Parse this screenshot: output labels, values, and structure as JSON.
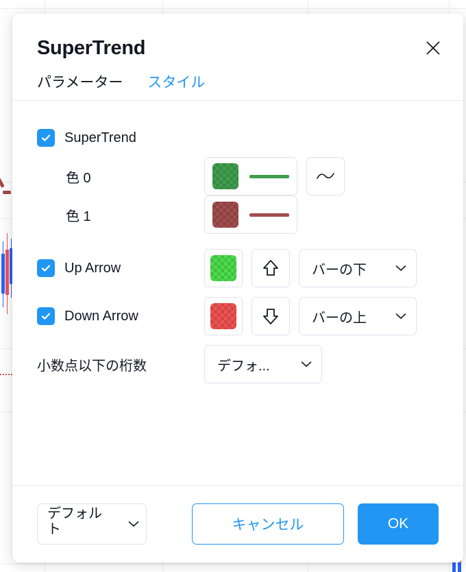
{
  "dialog": {
    "title": "SuperTrend",
    "close_icon": "close-icon",
    "tabs": [
      {
        "label": "パラメーター",
        "active": false
      },
      {
        "label": "スタイル",
        "active": true
      }
    ],
    "rows": [
      {
        "id": "supertrend",
        "label": "SuperTrend",
        "checked": true,
        "checkbox_color": "#2196f3"
      },
      {
        "id": "color-0",
        "label": "色 0",
        "swatch_color": "#3f9e4d",
        "line_color": "#3f9e4d",
        "line_style_icon": "wave-line-icon"
      },
      {
        "id": "color-1",
        "label": "色 1",
        "swatch_color": "#a34d4d",
        "line_color": "#a34d4d"
      },
      {
        "id": "up-arrow",
        "label": "Up Arrow",
        "checked": true,
        "swatch_color": "#4cdc4c",
        "arrow_icon": "arrow-up-icon",
        "position": "バーの下"
      },
      {
        "id": "down-arrow",
        "label": "Down Arrow",
        "checked": true,
        "swatch_color": "#f05252",
        "arrow_icon": "arrow-down-icon",
        "position": "バーの上"
      }
    ],
    "decimals": {
      "label": "小数点以下の桁数",
      "value": "デフォ..."
    },
    "footer": {
      "template_value": "デフォルト",
      "cancel_label": "キャンセル",
      "ok_label": "OK",
      "accent_color": "#2196f3"
    }
  }
}
